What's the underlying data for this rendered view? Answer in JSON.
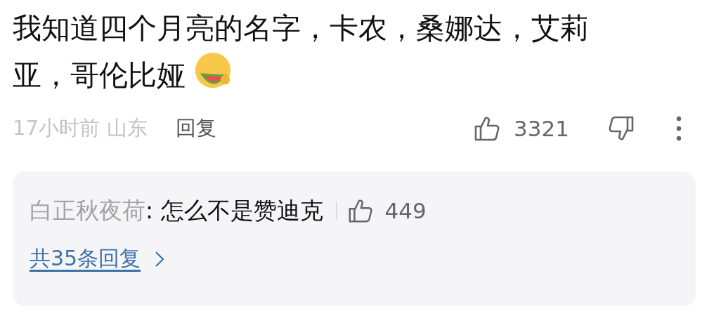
{
  "comment": {
    "text": "我知道四个月亮的名字，卡农，桑娜达，艾莉亚，哥伦比娅",
    "time": "17小时前",
    "location": "山东",
    "reply_label": "回复",
    "likes": "3321"
  },
  "replies": [
    {
      "author": "白正秋夜荷",
      "text": ": 怎么不是赞迪克",
      "likes": "449"
    }
  ],
  "more_replies": "共35条回复"
}
